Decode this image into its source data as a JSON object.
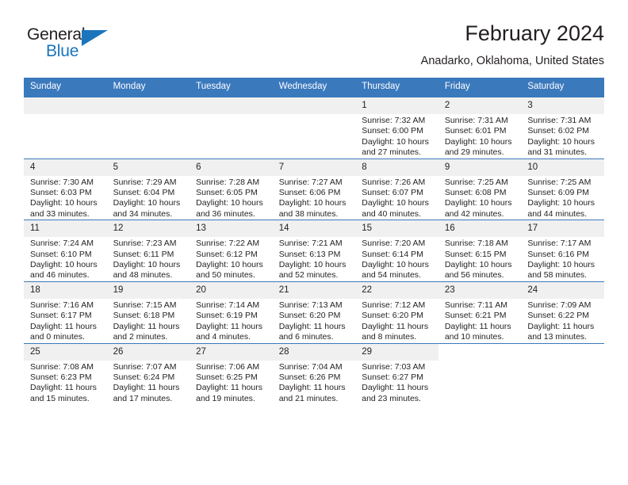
{
  "brand": {
    "name_part1": "General",
    "name_part2": "Blue",
    "triangle_color": "#1b75bc"
  },
  "header": {
    "title": "February 2024",
    "subtitle": "Anadarko, Oklahoma, United States"
  },
  "theme": {
    "header_blue": "#3b79bd",
    "date_band": "#f0f0f0",
    "text": "#231f20"
  },
  "weekday_headers": [
    "Sunday",
    "Monday",
    "Tuesday",
    "Wednesday",
    "Thursday",
    "Friday",
    "Saturday"
  ],
  "labels": {
    "sunrise_prefix": "Sunrise:",
    "sunset_prefix": "Sunset:",
    "daylight_prefix": "Daylight:"
  },
  "weeks": [
    [
      {
        "day": "",
        "blank": true
      },
      {
        "day": "",
        "blank": true
      },
      {
        "day": "",
        "blank": true
      },
      {
        "day": "",
        "blank": true
      },
      {
        "day": "1",
        "sunrise": "Sunrise: 7:32 AM",
        "sunset": "Sunset: 6:00 PM",
        "daylight_l1": "Daylight: 10 hours",
        "daylight_l2": "and 27 minutes."
      },
      {
        "day": "2",
        "sunrise": "Sunrise: 7:31 AM",
        "sunset": "Sunset: 6:01 PM",
        "daylight_l1": "Daylight: 10 hours",
        "daylight_l2": "and 29 minutes."
      },
      {
        "day": "3",
        "sunrise": "Sunrise: 7:31 AM",
        "sunset": "Sunset: 6:02 PM",
        "daylight_l1": "Daylight: 10 hours",
        "daylight_l2": "and 31 minutes."
      }
    ],
    [
      {
        "day": "4",
        "sunrise": "Sunrise: 7:30 AM",
        "sunset": "Sunset: 6:03 PM",
        "daylight_l1": "Daylight: 10 hours",
        "daylight_l2": "and 33 minutes."
      },
      {
        "day": "5",
        "sunrise": "Sunrise: 7:29 AM",
        "sunset": "Sunset: 6:04 PM",
        "daylight_l1": "Daylight: 10 hours",
        "daylight_l2": "and 34 minutes."
      },
      {
        "day": "6",
        "sunrise": "Sunrise: 7:28 AM",
        "sunset": "Sunset: 6:05 PM",
        "daylight_l1": "Daylight: 10 hours",
        "daylight_l2": "and 36 minutes."
      },
      {
        "day": "7",
        "sunrise": "Sunrise: 7:27 AM",
        "sunset": "Sunset: 6:06 PM",
        "daylight_l1": "Daylight: 10 hours",
        "daylight_l2": "and 38 minutes."
      },
      {
        "day": "8",
        "sunrise": "Sunrise: 7:26 AM",
        "sunset": "Sunset: 6:07 PM",
        "daylight_l1": "Daylight: 10 hours",
        "daylight_l2": "and 40 minutes."
      },
      {
        "day": "9",
        "sunrise": "Sunrise: 7:25 AM",
        "sunset": "Sunset: 6:08 PM",
        "daylight_l1": "Daylight: 10 hours",
        "daylight_l2": "and 42 minutes."
      },
      {
        "day": "10",
        "sunrise": "Sunrise: 7:25 AM",
        "sunset": "Sunset: 6:09 PM",
        "daylight_l1": "Daylight: 10 hours",
        "daylight_l2": "and 44 minutes."
      }
    ],
    [
      {
        "day": "11",
        "sunrise": "Sunrise: 7:24 AM",
        "sunset": "Sunset: 6:10 PM",
        "daylight_l1": "Daylight: 10 hours",
        "daylight_l2": "and 46 minutes."
      },
      {
        "day": "12",
        "sunrise": "Sunrise: 7:23 AM",
        "sunset": "Sunset: 6:11 PM",
        "daylight_l1": "Daylight: 10 hours",
        "daylight_l2": "and 48 minutes."
      },
      {
        "day": "13",
        "sunrise": "Sunrise: 7:22 AM",
        "sunset": "Sunset: 6:12 PM",
        "daylight_l1": "Daylight: 10 hours",
        "daylight_l2": "and 50 minutes."
      },
      {
        "day": "14",
        "sunrise": "Sunrise: 7:21 AM",
        "sunset": "Sunset: 6:13 PM",
        "daylight_l1": "Daylight: 10 hours",
        "daylight_l2": "and 52 minutes."
      },
      {
        "day": "15",
        "sunrise": "Sunrise: 7:20 AM",
        "sunset": "Sunset: 6:14 PM",
        "daylight_l1": "Daylight: 10 hours",
        "daylight_l2": "and 54 minutes."
      },
      {
        "day": "16",
        "sunrise": "Sunrise: 7:18 AM",
        "sunset": "Sunset: 6:15 PM",
        "daylight_l1": "Daylight: 10 hours",
        "daylight_l2": "and 56 minutes."
      },
      {
        "day": "17",
        "sunrise": "Sunrise: 7:17 AM",
        "sunset": "Sunset: 6:16 PM",
        "daylight_l1": "Daylight: 10 hours",
        "daylight_l2": "and 58 minutes."
      }
    ],
    [
      {
        "day": "18",
        "sunrise": "Sunrise: 7:16 AM",
        "sunset": "Sunset: 6:17 PM",
        "daylight_l1": "Daylight: 11 hours",
        "daylight_l2": "and 0 minutes."
      },
      {
        "day": "19",
        "sunrise": "Sunrise: 7:15 AM",
        "sunset": "Sunset: 6:18 PM",
        "daylight_l1": "Daylight: 11 hours",
        "daylight_l2": "and 2 minutes."
      },
      {
        "day": "20",
        "sunrise": "Sunrise: 7:14 AM",
        "sunset": "Sunset: 6:19 PM",
        "daylight_l1": "Daylight: 11 hours",
        "daylight_l2": "and 4 minutes."
      },
      {
        "day": "21",
        "sunrise": "Sunrise: 7:13 AM",
        "sunset": "Sunset: 6:20 PM",
        "daylight_l1": "Daylight: 11 hours",
        "daylight_l2": "and 6 minutes."
      },
      {
        "day": "22",
        "sunrise": "Sunrise: 7:12 AM",
        "sunset": "Sunset: 6:20 PM",
        "daylight_l1": "Daylight: 11 hours",
        "daylight_l2": "and 8 minutes."
      },
      {
        "day": "23",
        "sunrise": "Sunrise: 7:11 AM",
        "sunset": "Sunset: 6:21 PM",
        "daylight_l1": "Daylight: 11 hours",
        "daylight_l2": "and 10 minutes."
      },
      {
        "day": "24",
        "sunrise": "Sunrise: 7:09 AM",
        "sunset": "Sunset: 6:22 PM",
        "daylight_l1": "Daylight: 11 hours",
        "daylight_l2": "and 13 minutes."
      }
    ],
    [
      {
        "day": "25",
        "sunrise": "Sunrise: 7:08 AM",
        "sunset": "Sunset: 6:23 PM",
        "daylight_l1": "Daylight: 11 hours",
        "daylight_l2": "and 15 minutes."
      },
      {
        "day": "26",
        "sunrise": "Sunrise: 7:07 AM",
        "sunset": "Sunset: 6:24 PM",
        "daylight_l1": "Daylight: 11 hours",
        "daylight_l2": "and 17 minutes."
      },
      {
        "day": "27",
        "sunrise": "Sunrise: 7:06 AM",
        "sunset": "Sunset: 6:25 PM",
        "daylight_l1": "Daylight: 11 hours",
        "daylight_l2": "and 19 minutes."
      },
      {
        "day": "28",
        "sunrise": "Sunrise: 7:04 AM",
        "sunset": "Sunset: 6:26 PM",
        "daylight_l1": "Daylight: 11 hours",
        "daylight_l2": "and 21 minutes."
      },
      {
        "day": "29",
        "sunrise": "Sunrise: 7:03 AM",
        "sunset": "Sunset: 6:27 PM",
        "daylight_l1": "Daylight: 11 hours",
        "daylight_l2": "and 23 minutes."
      },
      {
        "day": "",
        "blank": true,
        "trailing": true
      },
      {
        "day": "",
        "blank": true,
        "trailing": true
      }
    ]
  ]
}
